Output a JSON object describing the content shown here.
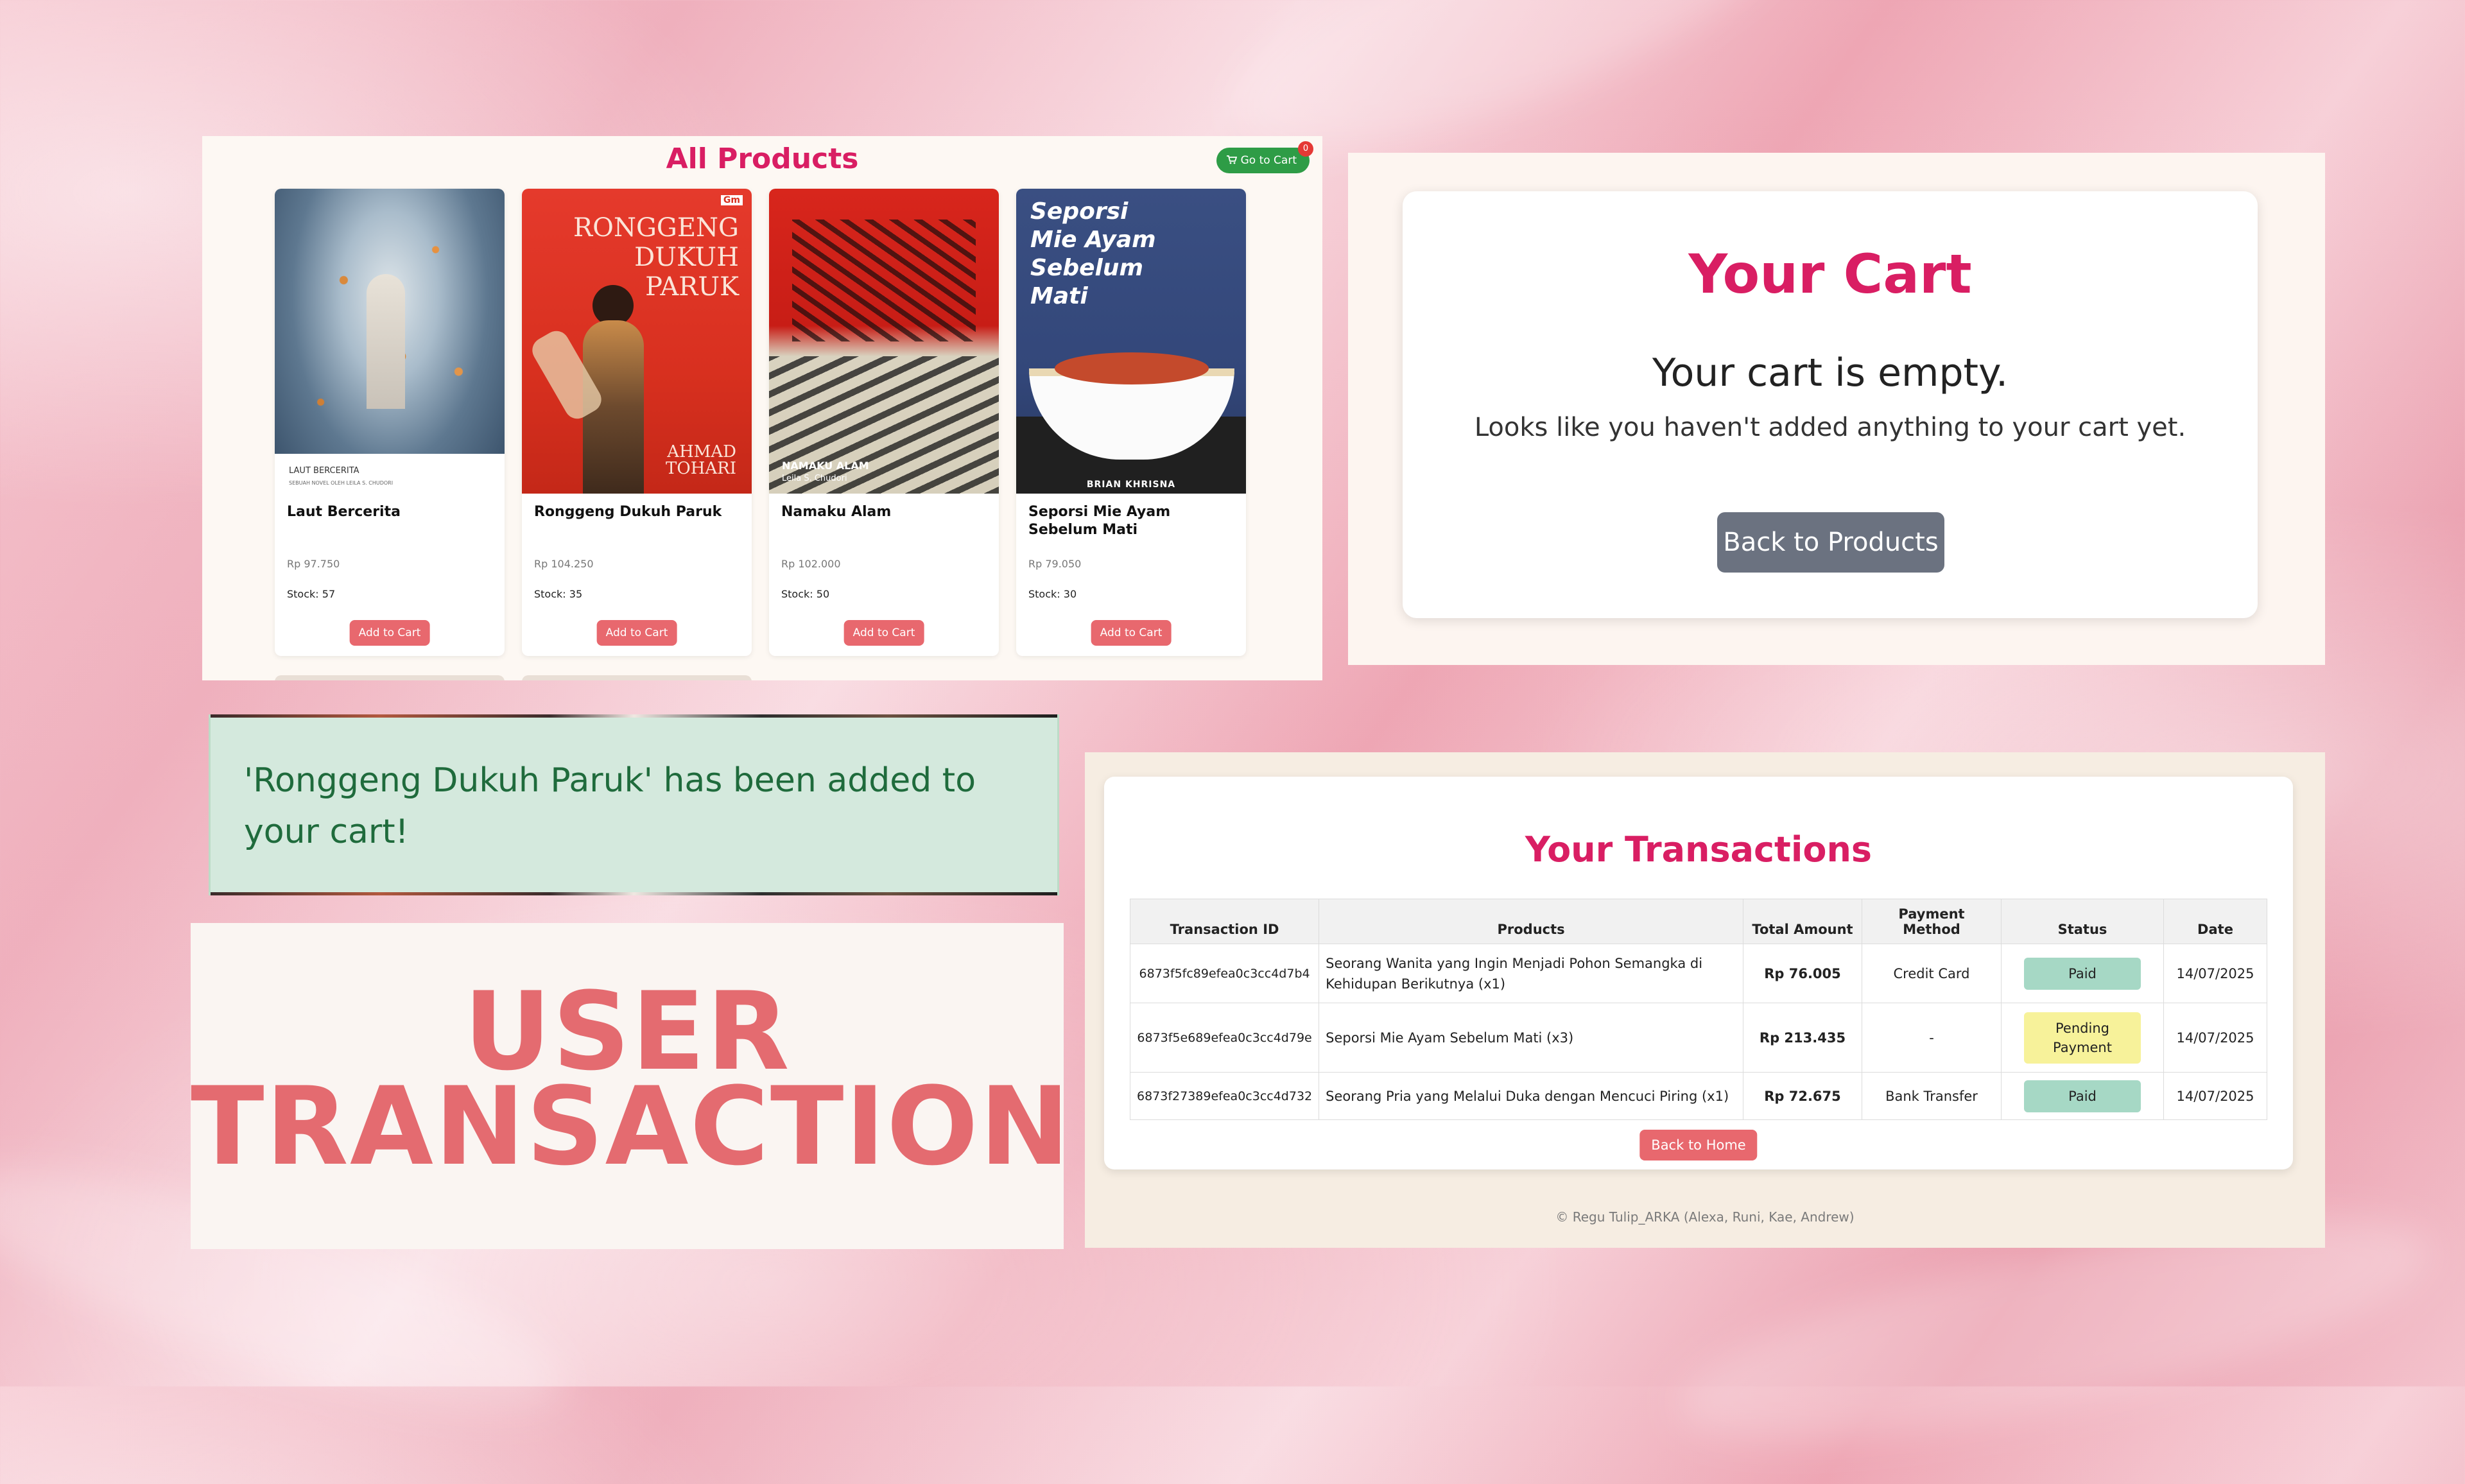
{
  "products_panel": {
    "title": "All Products",
    "go_to_cart_label": "Go to Cart",
    "cart_count": "0",
    "products": [
      {
        "title": "Laut Bercerita",
        "price": "Rp 97.750",
        "stock": "Stock: 57",
        "add_label": "Add to Cart",
        "cover_title": "LAUT BERCERITA",
        "cover_subtitle": "SEBUAH NOVEL OLEH LEILA S. CHUDORI"
      },
      {
        "title": "Ronggeng Dukuh Paruk",
        "price": "Rp 104.250",
        "stock": "Stock: 35",
        "add_label": "Add to Cart",
        "cover_title": "RONGGENG DUKUH PARUK",
        "cover_author": "AHMAD TOHARI",
        "cover_logo": "Gm"
      },
      {
        "title": "Namaku Alam",
        "price": "Rp 102.000",
        "stock": "Stock: 50",
        "add_label": "Add to Cart",
        "cover_title": "NAMAKU ALAM",
        "cover_author": "Leila S. Chudori"
      },
      {
        "title": "Seporsi Mie Ayam Sebelum Mati",
        "price": "Rp 79.050",
        "stock": "Stock: 30",
        "add_label": "Add to Cart",
        "cover_title": "Seporsi Mie Ayam Sebelum Mati",
        "cover_author": "BRIAN KHRISNA"
      }
    ]
  },
  "cart_panel": {
    "title": "Your Cart",
    "empty_message": "Your cart is empty.",
    "sub_message": "Looks like you haven't added anything to your cart yet.",
    "back_button": "Back to Products"
  },
  "alert": {
    "message": "'Ronggeng Dukuh Paruk' has been added to your cart!"
  },
  "label_panel": {
    "line1": "USER",
    "line2": "TRANSACTION"
  },
  "transactions_panel": {
    "title": "Your Transactions",
    "columns": [
      "Transaction ID",
      "Products",
      "Total Amount",
      "Payment Method",
      "Status",
      "Date"
    ],
    "rows": [
      {
        "id": "6873f5fc89efea0c3cc4d7b4",
        "products": "Seorang Wanita yang Ingin Menjadi Pohon Semangka di Kehidupan Berikutnya (x1)",
        "amount": "Rp 76.005",
        "payment": "Credit Card",
        "status": "Paid",
        "date": "14/07/2025"
      },
      {
        "id": "6873f5e689efea0c3cc4d79e",
        "products": "Seporsi Mie Ayam Sebelum Mati (x3)",
        "amount": "Rp 213.435",
        "payment": "-",
        "status": "Pending Payment",
        "date": "14/07/2025"
      },
      {
        "id": "6873f27389efea0c3cc4d732",
        "products": "Seorang Pria yang Melalui Duka dengan Mencuci Piring (x1)",
        "amount": "Rp 72.675",
        "payment": "Bank Transfer",
        "status": "Paid",
        "date": "14/07/2025"
      }
    ],
    "back_button": "Back to Home",
    "footer": "© Regu Tulip_ARKA (Alexa, Runi, Kae, Andrew)"
  },
  "colors": {
    "accent": "#d91e63",
    "add_button": "#e8686e",
    "label": "#e46b70",
    "paid": "#a6d8c5",
    "pending": "#f7f29a",
    "go_to_cart": "#2e9c46"
  },
  "icons": {
    "cart": "cart-icon"
  }
}
